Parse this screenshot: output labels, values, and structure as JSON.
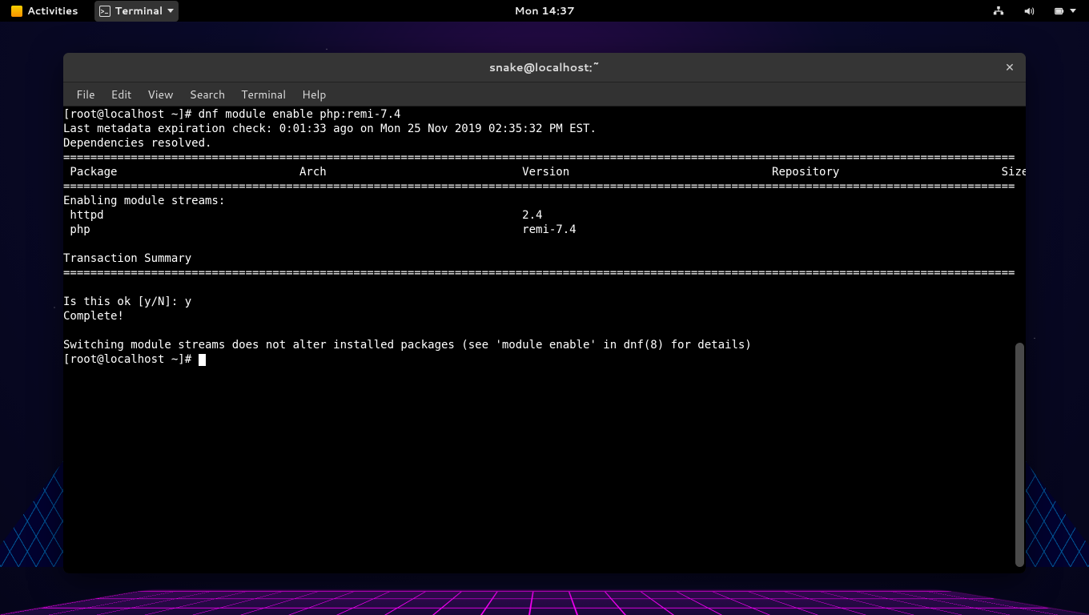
{
  "topbar": {
    "activities": "Activities",
    "app_name": "Terminal",
    "clock": "Mon 14:37"
  },
  "window": {
    "title": "snake@localhost:~"
  },
  "menubar": {
    "file": "File",
    "edit": "Edit",
    "view": "View",
    "search": "Search",
    "terminal": "Terminal",
    "help": "Help"
  },
  "terminal": {
    "prompt1": "[root@localhost ~]# ",
    "cmd1": "dnf module enable php:remi-7.4",
    "line_meta": "Last metadata expiration check: 0:01:33 ago on Mon 25 Nov 2019 02:35:32 PM EST.",
    "line_deps": "Dependencies resolved.",
    "header_cols": " Package                           Arch                             Version                              Repository                        Size",
    "enable_heading": "Enabling module streams:",
    "row_httpd": " httpd                                                              2.4",
    "row_php": " php                                                                remi-7.4",
    "tx_summary": "Transaction Summary",
    "confirm": "Is this ok [y/N]: y",
    "complete": "Complete!",
    "note": "Switching module streams does not alter installed packages (see 'module enable' in dnf(8) for details)",
    "prompt2": "[root@localhost ~]# "
  }
}
